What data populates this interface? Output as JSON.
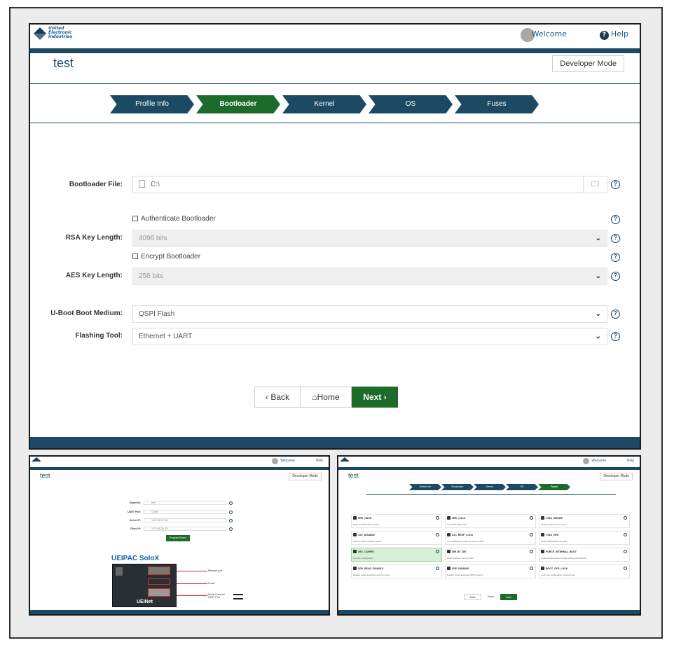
{
  "header": {
    "logo_text": "United\nElectronic\nIndustries",
    "welcome": "Welcome",
    "help": "Help"
  },
  "page": {
    "title": "test",
    "developer_mode": "Developer Mode"
  },
  "steps": [
    {
      "label": "Profile Info",
      "active": false
    },
    {
      "label": "Bootloader",
      "active": true
    },
    {
      "label": "Kernel",
      "active": false
    },
    {
      "label": "OS",
      "active": false
    },
    {
      "label": "Fuses",
      "active": false
    }
  ],
  "form": {
    "bootloader_file_label": "Bootloader File:",
    "bootloader_file_value": "C:\\",
    "authenticate_label": "Authenticate Bootloader",
    "rsa_label": "RSA Key Length:",
    "rsa_value": "4096 bits",
    "encrypt_label": "Encrypt Bootloader",
    "aes_label": "AES Key Length:",
    "aes_value": "256 bits",
    "uboot_label": "U-Boot Boot Medium:",
    "uboot_value": "QSPI Flash",
    "flashing_label": "Flashing Tool:",
    "flashing_value": "Ethernet + UART"
  },
  "nav": {
    "back": "Back",
    "home": "Home",
    "next": "Next"
  },
  "thumb1": {
    "title": "test",
    "developer_mode": "Developer Mode",
    "welcome": "Welcome",
    "help": "Help",
    "fields": [
      {
        "label": "Board ID:",
        "value": "test"
      },
      {
        "label": "UART Port:",
        "value": "COM5"
      },
      {
        "label": "Server IP:",
        "value": "192.168.37.100"
      },
      {
        "label": "Client IP:",
        "value": "192.168.38.100"
      }
    ],
    "program_button": "Program Board",
    "board_title": "UEIPAC SoloX",
    "annotations": [
      "Ethernet port",
      "Power",
      "Serial Console/ UART Port"
    ]
  },
  "thumb2": {
    "title": "test",
    "developer_mode": "Developer Mode",
    "welcome": "Welcome",
    "help": "Help",
    "steps": [
      "Profile Info",
      "Bootloader",
      "Kernel",
      "OS",
      "Fuses"
    ],
    "fuses": [
      {
        "name": "SRK_HASH",
        "desc": "Write the SRK hash in fuses",
        "highlight": false
      },
      {
        "name": "SRK_LOCK",
        "desc": "Lock SRK hash fuses",
        "highlight": false
      },
      {
        "name": "JTAG_SMODE",
        "desc": "Debug JTAG security mode",
        "highlight": false
      },
      {
        "name": "SJC_DISABLE",
        "desc": "Secure JTAG controller mode",
        "highlight": false
      },
      {
        "name": "SJC_RESP_LOCK",
        "desc": "Lock password protect for secure JTAG",
        "highlight": false
      },
      {
        "name": "JTAG_HEO",
        "desc": "JTAG HAB Enable Override",
        "highlight": false
      },
      {
        "name": "SEC_CONFIG",
        "desc": "Security configuration",
        "highlight": true
      },
      {
        "name": "DIR_BT_DIS",
        "desc": "Direct external memory boot",
        "highlight": false
      },
      {
        "name": "FORCE_INTERNAL_BOOT",
        "desc": "Locked external boot media, forcing internal boot",
        "highlight": false
      },
      {
        "name": "SDP_READ_DISABLE",
        "desc": "Disable serial download read command",
        "highlight": false
      },
      {
        "name": "SDP_DISABLE",
        "desc": "Disable serial download (SDP) support",
        "highlight": false
      },
      {
        "name": "BOOT_CFG_LOCK",
        "desc": "Lock boot configuration related fuses",
        "highlight": false
      }
    ],
    "back": "Back",
    "home": "Home",
    "save": "Save"
  }
}
